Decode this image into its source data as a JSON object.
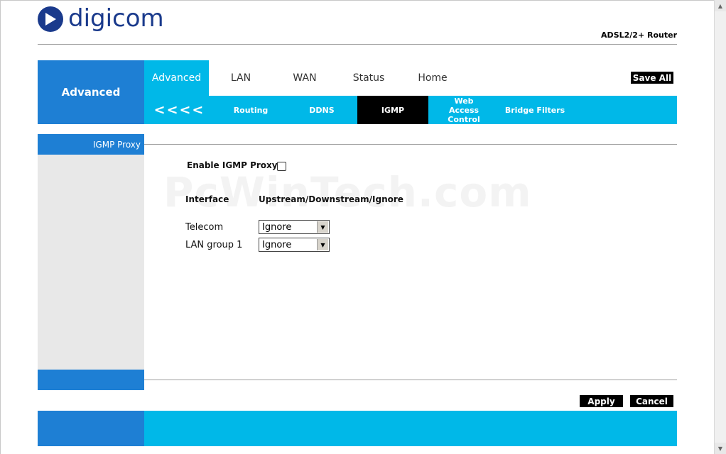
{
  "brand": {
    "logo_text": "digicom",
    "product": "ADSL2/2+ Router"
  },
  "main_nav": {
    "section_title": "Advanced",
    "tabs": [
      {
        "label": "Advanced",
        "active": true
      },
      {
        "label": "LAN"
      },
      {
        "label": "WAN"
      },
      {
        "label": "Status"
      },
      {
        "label": "Home"
      }
    ],
    "save_all": "Save All"
  },
  "sub_nav": {
    "back": "<<<<",
    "items": [
      {
        "label": "Routing"
      },
      {
        "label": "DDNS"
      },
      {
        "label": "IGMP",
        "active": true
      },
      {
        "label": "Web Access Control"
      },
      {
        "label": "Bridge Filters"
      }
    ]
  },
  "sidebar": {
    "title": "IGMP Proxy"
  },
  "form": {
    "enable_label": "Enable IGMP Proxy",
    "enable_checked": false,
    "col_interface": "Interface",
    "col_mode": "Upstream/Downstream/Ignore",
    "rows": [
      {
        "interface": "Telecom",
        "mode": "Ignore"
      },
      {
        "interface": "LAN group 1",
        "mode": "Ignore"
      }
    ]
  },
  "buttons": {
    "apply": "Apply",
    "cancel": "Cancel"
  },
  "watermark": "PcWinTech.com",
  "colors": {
    "primary_blue": "#1e7fd4",
    "accent_cyan": "#00b8e8",
    "brand_navy": "#1a3a8c"
  }
}
